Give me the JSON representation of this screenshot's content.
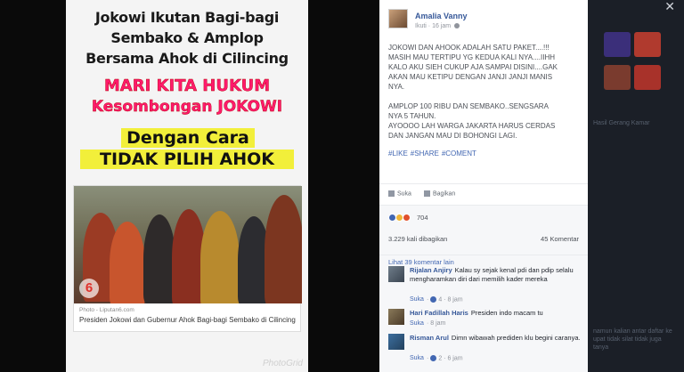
{
  "photo": {
    "title_lines": [
      "Jokowi Ikutan Bagi-bagi",
      "Sembako & Amplop",
      "Bersama Ahok di Cilincing"
    ],
    "red_line1": "MARI KITA HUKUM",
    "red_line2": "Kesombongan JOKOWI",
    "yellow_line1": "Dengan Cara",
    "yellow_line2": "TIDAK PILIH AHOK",
    "news_logo": "6",
    "news_source": "Photo - Liputan6.com",
    "news_caption": "Presiden Jokowi dan Gubernur Ahok Bagi-bagi Sembako di Cilincing",
    "watermark": "PhotoGrid"
  },
  "post": {
    "author": "Amalia Vanny",
    "follow": "Ikuti",
    "time": "16 jam",
    "text": "JOKOWI DAN AHOOK ADALAH SATU PAKET....!!!\nMASIH MAU TERTIPU YG KEDUA KALI NYA....IIHH\nKALO AKU SIEH CUKUP AJA SAMPAI DISINI....GAK\nAKAN MAU KETIPU DENGAN JANJI JANJI MANIS\nNYA.\n\nAMPLOP 100 RIBU DAN SEMBAKO..SENGSARA\nNYA 5 TAHUN.\nAYOOOO LAH WARGA JAKARTA HARUS CERDAS\nDAN JANGAN MAU DI BOHONGI LAGI.",
    "hashtags": [
      "#LIKE",
      "#SHARE",
      "#COMENT"
    ],
    "like_label": "Suka",
    "share_label": "Bagikan",
    "reaction_count": "704",
    "shares": "3.229 kali dibagikan",
    "comments_count": "45 Komentar",
    "more_comments": "Lihat 39 komentar lain"
  },
  "comments": [
    {
      "name": "Rijalan Anjiry",
      "text": "Kalau sy sejak kenal pdi dan pdip selalu mengharamkan diri dari memilih kader mereka",
      "like": "Suka",
      "likes": "4",
      "time": "8 jam"
    },
    {
      "name": "Hari Fadillah Haris",
      "text": "Presiden indo macam tu",
      "like": "Suka",
      "likes": "",
      "time": "8 jam"
    },
    {
      "name": "Risman Arul",
      "text": "Dimn wibawah prediden klu begini caranya.",
      "like": "Suka",
      "likes": "2",
      "time": "6 jam"
    }
  ],
  "background": {
    "close": "✕",
    "side_text1": "Hasil Gerang Kamar",
    "side_text2": "namun kalian antar daftar ke upat tidak silat tidak juga tanya"
  },
  "colors": {
    "link": "#365899",
    "hashtag": "#4267b2",
    "poster_red": "#ff1a6e",
    "poster_yellow": "#f2ef3a"
  }
}
